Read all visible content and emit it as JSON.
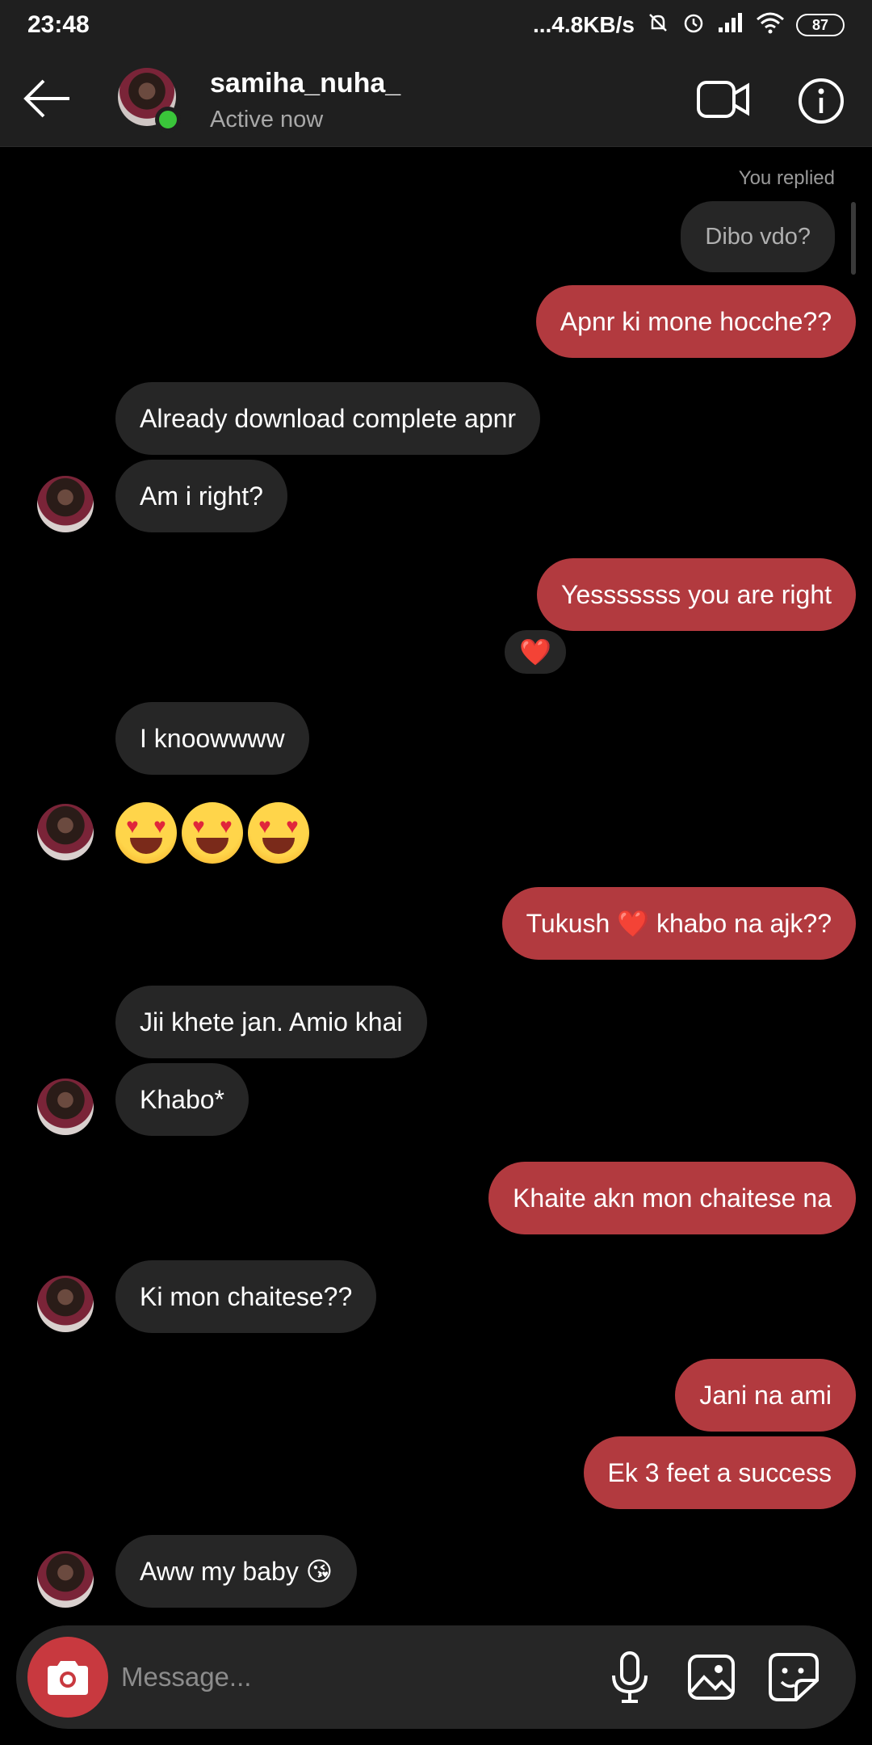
{
  "status_bar": {
    "time": "23:48",
    "network_speed": "...4.8KB/s",
    "battery": "87"
  },
  "header": {
    "username": "samiha_nuha_",
    "status": "Active now"
  },
  "thread": {
    "replied_label": "You replied",
    "reply_quote": "Dibo vdo?",
    "messages": [
      {
        "side": "out",
        "text": "Apnr ki mone hocche??"
      },
      {
        "side": "in",
        "text": "Already download complete apnr"
      },
      {
        "side": "in",
        "text": "Am i right?"
      },
      {
        "side": "out",
        "text": "Yesssssss you are right"
      },
      {
        "side": "in",
        "text": "I knoowwww"
      },
      {
        "side": "in",
        "text": "😍😍😍"
      },
      {
        "side": "out",
        "text": "Tukush ❤️ khabo na ajk??"
      },
      {
        "side": "in",
        "text": "Jii khete jan. Amio khai"
      },
      {
        "side": "in",
        "text": "Khabo*"
      },
      {
        "side": "out",
        "text": "Khaite akn mon chaitese na"
      },
      {
        "side": "in",
        "text": "Ki mon chaitese??"
      },
      {
        "side": "out",
        "text": "Jani na ami"
      },
      {
        "side": "out",
        "text": "Ek 3 feet a success"
      },
      {
        "side": "in",
        "text": "Aww my baby 😘"
      }
    ],
    "reaction": "❤️"
  },
  "composer": {
    "placeholder": "Message..."
  },
  "colors": {
    "outgoing_bubble": "#b23a3f",
    "incoming_bubble": "#262626",
    "online": "#3ac53a",
    "camera_button": "#c8393f"
  }
}
